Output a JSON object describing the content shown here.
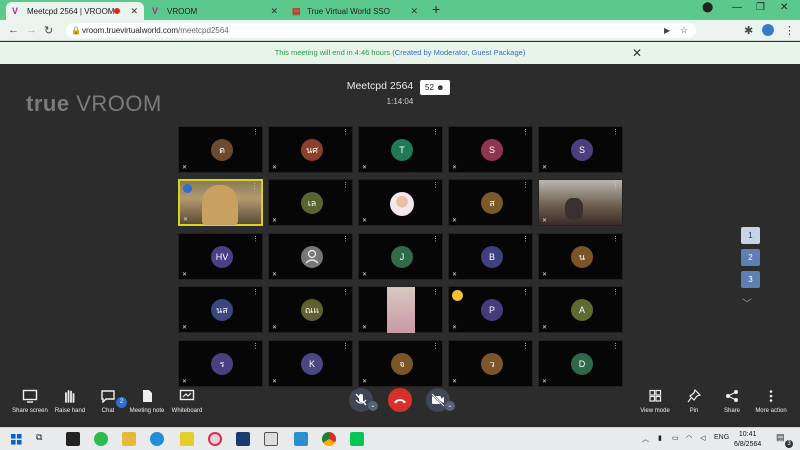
{
  "browser": {
    "tabs": [
      {
        "title": "Meetcpd 2564 | VROOM",
        "recording": true
      },
      {
        "title": "VROOM"
      },
      {
        "title": "True Virtual World SSO"
      }
    ],
    "new_tab": "+",
    "url_host": "vroom.truevirtualworld.com",
    "url_path": "/meetcpd2564"
  },
  "notice": {
    "text": "This meeting will end in 4:46 hours",
    "detail": "(Created by Moderator, Guest Package)"
  },
  "meeting": {
    "logo_bold": "true",
    "logo_light": "VROOM",
    "title": "Meetcpd 2564",
    "timer": "1:14:04",
    "participant_count": "52"
  },
  "grid": [
    [
      {
        "initials": "ต",
        "color": "#6b4a30"
      },
      {
        "initials": "นศ",
        "color": "#8b3f2c"
      },
      {
        "initials": "T",
        "color": "#1f7a58"
      },
      {
        "initials": "S",
        "color": "#8f3552"
      },
      {
        "initials": "S",
        "color": "#4c3f80"
      }
    ],
    [
      {
        "initials": "",
        "video": "presenter",
        "speaking": true
      },
      {
        "initials": "เล",
        "color": "#5a6430"
      },
      {
        "initials": "",
        "video": "woman"
      },
      {
        "initials": "ส",
        "color": "#7a5a28"
      },
      {
        "initials": "",
        "video": "room"
      }
    ],
    [
      {
        "initials": "HV",
        "color": "#4b3f85"
      },
      {
        "initials": "",
        "color": "#777777",
        "generic": true
      },
      {
        "initials": "J",
        "color": "#2f6b48"
      },
      {
        "initials": "B",
        "color": "#404080"
      },
      {
        "initials": "น",
        "color": "#7a5526"
      }
    ],
    [
      {
        "initials": "นส",
        "color": "#3c4680"
      },
      {
        "initials": "ณแ",
        "color": "#5f6230"
      },
      {
        "initials": "",
        "video": "pink"
      },
      {
        "initials": "P",
        "color": "#463c7c",
        "hand": true
      },
      {
        "initials": "A",
        "color": "#5f6a32"
      }
    ],
    [
      {
        "initials": "ร",
        "color": "#4a3f80"
      },
      {
        "initials": "K",
        "color": "#4c4682"
      },
      {
        "initials": "จ",
        "color": "#7b5628"
      },
      {
        "initials": "ว",
        "color": "#7d562b"
      },
      {
        "initials": "D",
        "color": "#2d6a49"
      }
    ]
  ],
  "pager": [
    "1",
    "2",
    "3"
  ],
  "controls": {
    "share_screen": "Share screen",
    "raise_hand": "Raise hand",
    "chat": "Chat",
    "chat_badge": "2",
    "meeting_note": "Meeting note",
    "whiteboard": "Whiteboard",
    "view_mode": "View mode",
    "pin": "Pin",
    "share": "Share",
    "more_action": "More action"
  },
  "taskbar": {
    "lang": "ENG",
    "time": "10:41",
    "date": "6/8/2564",
    "notif_badge": "3"
  },
  "colors": {
    "accent_green": "#5cc98c",
    "end_call": "#d8302c",
    "pager_active": "#5d7fb3"
  }
}
